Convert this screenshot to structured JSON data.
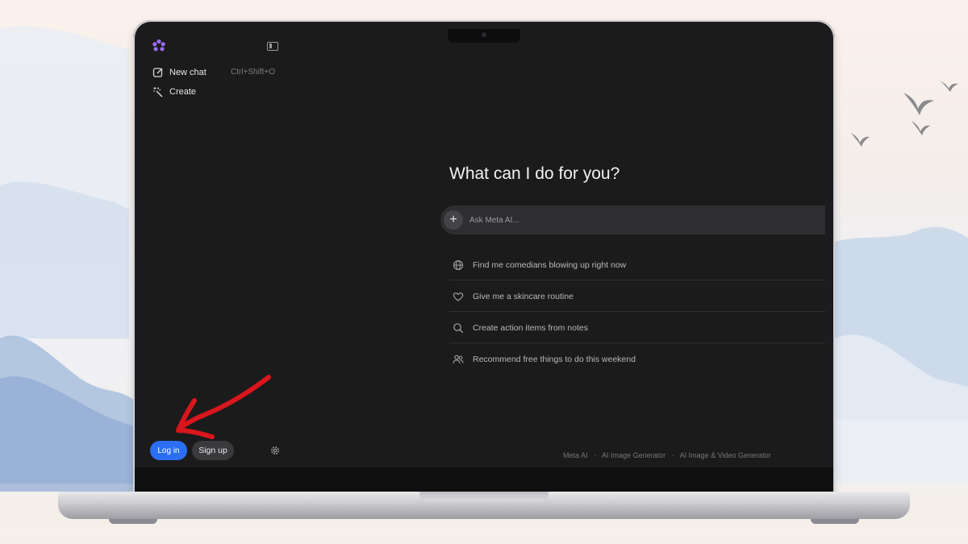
{
  "sidebar": {
    "new_chat_label": "New chat",
    "new_chat_shortcut": "Ctrl+Shift+O",
    "create_label": "Create",
    "login_label": "Log in",
    "signup_label": "Sign up"
  },
  "main": {
    "headline": "What can I do for you?",
    "ask_placeholder": "Ask Meta AI...",
    "suggestions": [
      {
        "icon": "globe-icon",
        "label": "Find me comedians blowing up right now"
      },
      {
        "icon": "heart-icon",
        "label": "Give me a skincare routine"
      },
      {
        "icon": "search-icon",
        "label": "Create action items from notes"
      },
      {
        "icon": "people-icon",
        "label": "Recommend free things to do this weekend"
      }
    ]
  },
  "footer": {
    "links": [
      "Meta AI",
      "AI Image Generator",
      "AI Image & Video Generator"
    ],
    "separator": "·"
  },
  "colors": {
    "accent": "#2b6ef5",
    "screen_bg": "#1b1b1c",
    "annotation_arrow": "#d9161c"
  }
}
